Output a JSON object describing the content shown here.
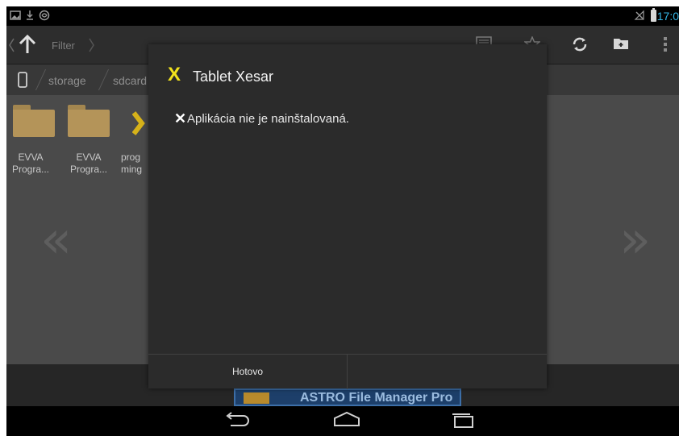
{
  "status_bar": {
    "clock": "17:0",
    "icons": [
      "screenshot-icon",
      "download-icon",
      "android-icon",
      "no-signal-icon",
      "battery-icon"
    ]
  },
  "action_bar": {
    "filter_label": "Filter",
    "icons": [
      "back-icon",
      "up-arrow-icon",
      "view-icon",
      "star-icon",
      "refresh-icon",
      "new-folder-icon",
      "overflow-menu-icon"
    ]
  },
  "breadcrumb": {
    "items": [
      "storage",
      "sdcard"
    ]
  },
  "files": [
    {
      "line1": "EVVA",
      "line2": "Progra..."
    },
    {
      "line1": "EVVA",
      "line2": "Progra..."
    },
    {
      "line1": "prog",
      "line2": "ming"
    }
  ],
  "ad": {
    "text": "ASTRO File Manager Pro"
  },
  "dialog": {
    "title_icon": "X",
    "title": "Tablet Xesar",
    "message_icon": "✕",
    "message": "Aplikácia nie je nainštalovaná.",
    "done_label": "Hotovo"
  },
  "colors": {
    "accent_yellow": "#f2e21c",
    "clock_blue": "#33b5e5",
    "dialog_bg": "#2b2b2b"
  }
}
